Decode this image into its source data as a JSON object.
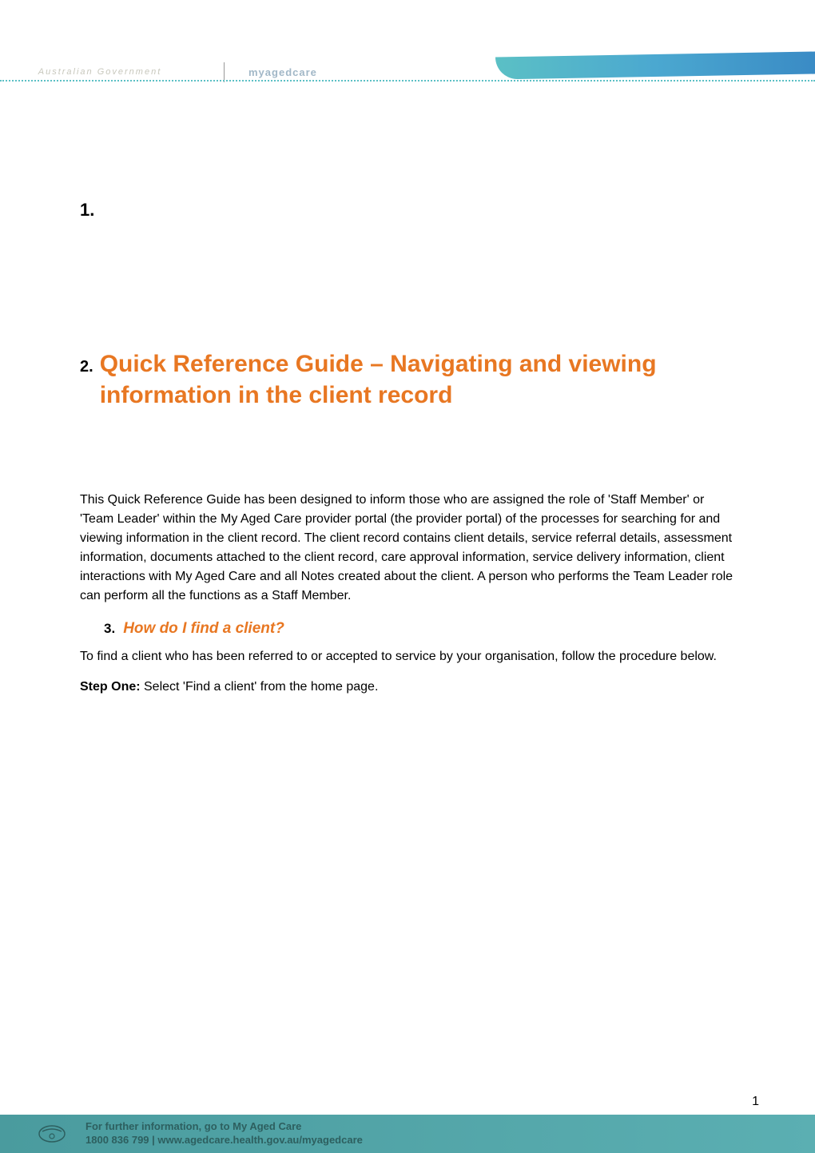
{
  "header": {
    "logo_left_text": "Australian Government",
    "logo_center_text": "myagedcare"
  },
  "content": {
    "number_1": "1.",
    "number_2": "2.",
    "main_title": "Quick Reference Guide – Navigating and viewing information in the client record",
    "intro_paragraph": "This Quick Reference Guide has been designed to inform those who are assigned the role of 'Staff Member' or 'Team Leader' within the My Aged Care provider portal (the provider portal) of the processes for searching for and viewing information in the client record. The client record contains client details, service referral details, assessment information, documents attached to the client record, care approval information, service delivery information, client interactions with My Aged Care and all Notes created about the client. A person who performs the Team Leader role can perform all the functions as a Staff Member.",
    "number_3": "3.",
    "section_heading": "How do I find a client?",
    "body_text": "To find a client who has been referred to or accepted to service by your organisation, follow the procedure below.",
    "step_label": "Step One:",
    "step_text": " Select 'Find a client' from the home page."
  },
  "footer": {
    "line1": "For further information, go to My Aged Care",
    "line2": "1800 836 799 | www.agedcare.health.gov.au/myagedcare",
    "page_number": "1"
  }
}
